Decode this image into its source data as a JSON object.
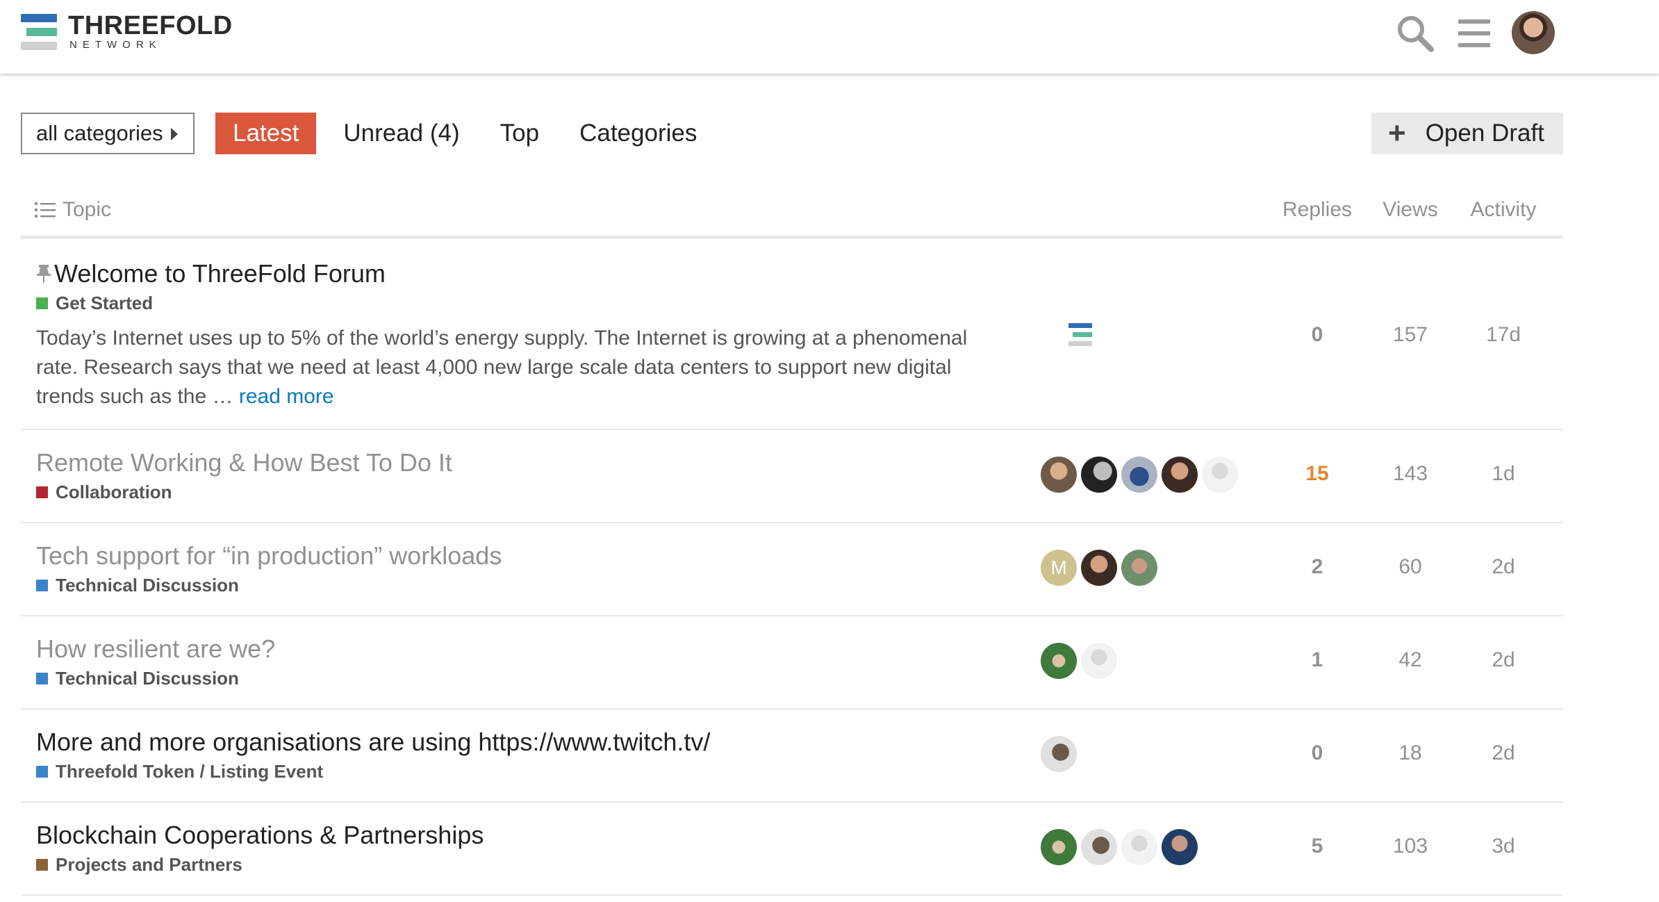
{
  "header": {
    "logo_title": "THREEFOLD",
    "logo_sub": "NETWORK",
    "logo_colors": [
      "#2f6db5",
      "#5ab89a",
      "#cfcfcf"
    ],
    "search_icon": "search-icon",
    "menu_icon": "hamburger-icon"
  },
  "nav": {
    "category_dropdown": "all categories",
    "tabs": [
      "Latest",
      "Unread (4)",
      "Top",
      "Categories"
    ],
    "active_tab": "Latest",
    "open_draft": "Open Draft",
    "accent_color": "#d9573b"
  },
  "table": {
    "headers": {
      "topic": "Topic",
      "replies": "Replies",
      "views": "Views",
      "activity": "Activity"
    },
    "topics": [
      {
        "title": "Welcome to ThreeFold Forum",
        "pinned": true,
        "unread": true,
        "category": "Get Started",
        "category_color": "#4caf50",
        "excerpt": "Today’s Internet uses up to 5% of the world’s energy supply. The Internet is growing at a phenomenal rate. Research says that we need at least 4,000 new large scale data centers to support new digital trends such as the …",
        "read_more": "read more",
        "replies": "0",
        "views": "157",
        "activity": "17d"
      },
      {
        "title": "Remote Working & How Best To Do It",
        "unread": false,
        "category": "Collaboration",
        "category_color": "#b3262f",
        "replies": "15",
        "replies_hot": true,
        "views": "143",
        "activity": "1d"
      },
      {
        "title": "Tech support for “in production” workloads",
        "unread": false,
        "category": "Technical Discussion",
        "category_color": "#3a84c9",
        "replies": "2",
        "views": "60",
        "activity": "2d"
      },
      {
        "title": "How resilient are we?",
        "unread": false,
        "category": "Technical Discussion",
        "category_color": "#3a84c9",
        "replies": "1",
        "views": "42",
        "activity": "2d"
      },
      {
        "title": "More and more organisations are using https://www.twitch.tv/",
        "unread": true,
        "category": "Threefold Token / Listing Event",
        "category_color": "#3a84c9",
        "replies": "0",
        "views": "18",
        "activity": "2d"
      },
      {
        "title": "Blockchain Cooperations & Partnerships",
        "unread": true,
        "category": "Projects and Partners",
        "category_color": "#8c6239",
        "replies": "5",
        "views": "103",
        "activity": "3d"
      }
    ],
    "avatar_letter": "M"
  }
}
